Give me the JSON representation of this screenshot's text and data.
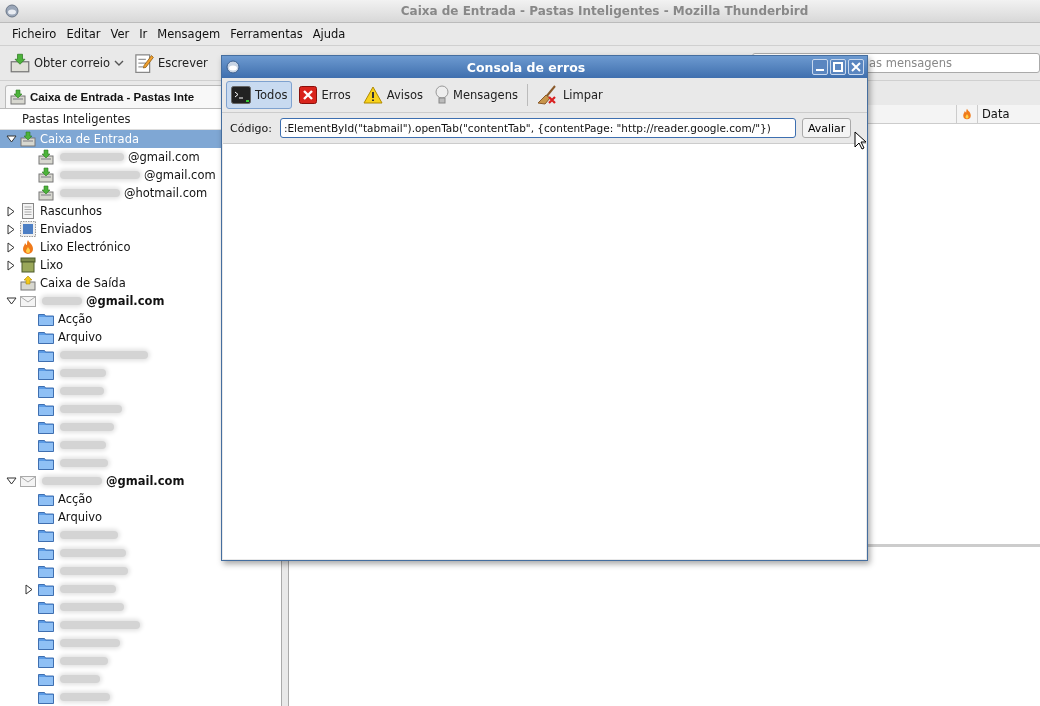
{
  "window": {
    "title": "Caixa de Entrada - Pastas Inteligentes - Mozilla Thunderbird"
  },
  "menu": [
    "Ficheiro",
    "Editar",
    "Ver",
    "Ir",
    "Mensagem",
    "Ferramentas",
    "Ajuda"
  ],
  "toolbar": [
    {
      "label": "Obter correio",
      "kind": "get",
      "dropdown": true
    },
    {
      "label": "Escrever",
      "kind": "write",
      "dropdown": false
    }
  ],
  "search": {
    "text": "as mensagens"
  },
  "tab": {
    "label": "Caixa de Entrada - Pastas Inte"
  },
  "folder_pane": {
    "header": "Pastas Inteligentes",
    "tree": [
      {
        "label": "Caixa de Entrada",
        "kind": "inbox",
        "expanded": true,
        "selected": true,
        "children": [
          {
            "label": "@gmail.com",
            "kind": "inbox",
            "blurred": true,
            "selected": false
          },
          {
            "label": "@gmail.com",
            "kind": "inbox",
            "blurred": true,
            "selected": false
          },
          {
            "label": "@hotmail.com",
            "kind": "inbox",
            "blurred": true,
            "selected": false
          }
        ]
      },
      {
        "label": "Rascunhos",
        "kind": "drafts",
        "expanded": false,
        "selected": false
      },
      {
        "label": "Enviados",
        "kind": "sent",
        "expanded": false,
        "selected": false
      },
      {
        "label": "Lixo Electrónico",
        "kind": "junk",
        "expanded": false,
        "selected": false
      },
      {
        "label": "Lixo",
        "kind": "trash",
        "expanded": false,
        "selected": false
      },
      {
        "label": "Caixa de Saída",
        "kind": "outbox",
        "selected": false
      },
      {
        "label": "@gmail.com",
        "kind": "account",
        "blurred": true,
        "expanded": true,
        "selected": false,
        "children": [
          {
            "label": "Acção",
            "kind": "folder",
            "selected": false
          },
          {
            "label": "Arquivo",
            "kind": "folder",
            "selected": false
          },
          {
            "kind": "folder",
            "blurred": true,
            "selected": false
          },
          {
            "kind": "folder",
            "blurred": true,
            "selected": false
          },
          {
            "kind": "folder",
            "blurred": true,
            "selected": false
          },
          {
            "kind": "folder",
            "blurred": true,
            "selected": false
          },
          {
            "kind": "folder",
            "blurred": true,
            "selected": false
          },
          {
            "kind": "folder",
            "blurred": true,
            "selected": false
          },
          {
            "kind": "folder",
            "blurred": true,
            "selected": false
          }
        ]
      },
      {
        "label": "@gmail.com",
        "kind": "account",
        "blurred": true,
        "expanded": true,
        "selected": false,
        "children": [
          {
            "label": "Acção",
            "kind": "folder",
            "selected": false
          },
          {
            "label": "Arquivo",
            "kind": "folder",
            "selected": false
          },
          {
            "kind": "folder",
            "blurred": true,
            "selected": false
          },
          {
            "kind": "folder",
            "blurred": true,
            "selected": false
          },
          {
            "kind": "folder",
            "blurred": true,
            "selected": false
          },
          {
            "kind": "folder",
            "blurred": true,
            "expanded": false,
            "selected": false
          },
          {
            "kind": "folder",
            "blurred": true,
            "selected": false
          },
          {
            "kind": "folder",
            "blurred": true,
            "selected": false
          },
          {
            "kind": "folder",
            "blurred": true,
            "selected": false
          },
          {
            "kind": "folder",
            "blurred": true,
            "selected": false
          },
          {
            "kind": "folder",
            "blurred": true,
            "selected": false
          },
          {
            "kind": "folder",
            "blurred": true,
            "selected": false
          }
        ]
      }
    ]
  },
  "message_list": {
    "columns": [
      {
        "kind": "junk-icon"
      },
      {
        "kind": "text",
        "label": "Data"
      }
    ]
  },
  "dialog": {
    "title": "Consola de erros",
    "filters": [
      {
        "label": "Todos",
        "kind": "console",
        "selected": true
      },
      {
        "label": "Erros",
        "kind": "error",
        "selected": false
      },
      {
        "label": "Avisos",
        "kind": "warning",
        "selected": false
      },
      {
        "label": "Mensagens",
        "kind": "bulb",
        "selected": false
      }
    ],
    "clear": "Limpar",
    "code_label": "Código:",
    "code_value": ":ElementById(\"tabmail\").openTab(\"contentTab\",  {contentPage:  \"http://reader.google.com/\"})",
    "evaluate": "Avaliar"
  }
}
